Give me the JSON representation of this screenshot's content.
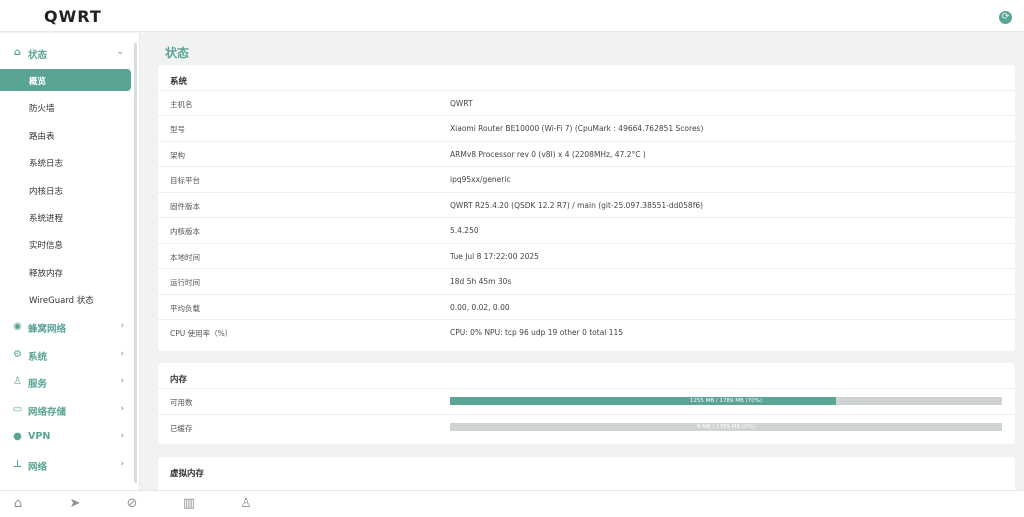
{
  "header": {
    "brand": "QWRT",
    "refresh_icon": "refresh-icon"
  },
  "sidebar": {
    "groups": [
      {
        "label": "状态",
        "icon": "home-icon"
      },
      {
        "label": "蜂窝网络",
        "icon": "cellular-icon"
      },
      {
        "label": "系统",
        "icon": "gear-icon"
      },
      {
        "label": "服务",
        "icon": "user-icon"
      },
      {
        "label": "网络存储",
        "icon": "storage-icon"
      },
      {
        "label": "VPN",
        "icon": "globe-icon"
      },
      {
        "label": "网络",
        "icon": "network-icon"
      }
    ],
    "status_items": [
      "概览",
      "防火墙",
      "路由表",
      "系统日志",
      "内核日志",
      "系统进程",
      "实时信息",
      "释放内存",
      "WireGuard 状态"
    ],
    "active_item": "概览"
  },
  "main": {
    "page_title": "状态",
    "system": {
      "title": "系统",
      "rows": [
        {
          "k": "主机名",
          "v": "QWRT"
        },
        {
          "k": "型号",
          "v": "Xiaomi Router BE10000 (Wi-Fi 7) (CpuMark : 49664.762851 Scores)"
        },
        {
          "k": "架构",
          "v": "ARMv8 Processor rev 0 (v8l) x 4 (2208MHz, 47.2°C )"
        },
        {
          "k": "目标平台",
          "v": "ipq95xx/generic"
        },
        {
          "k": "固件版本",
          "v": "QWRT R25.4.20 (QSDK 12.2 R7) / main (git-25.097.38551-dd058f6)"
        },
        {
          "k": "内核版本",
          "v": "5.4.250"
        },
        {
          "k": "本地时间",
          "v": "Tue Jul 8 17:22:00 2025"
        },
        {
          "k": "运行时间",
          "v": "18d 5h 45m 30s"
        },
        {
          "k": "平均负载",
          "v": "0.00, 0.02, 0.00"
        },
        {
          "k": "CPU 使用率（%）",
          "v": "CPU: 0% NPU: tcp 96 udp 19 other 0 total 115"
        }
      ]
    },
    "memory": {
      "title": "内存",
      "rows": [
        {
          "k": "可用数",
          "text": "1255 MB / 1789 MB (70%)",
          "fraction": 0.7
        },
        {
          "k": "已缓存",
          "text": "9 MB / 1789 MB (0%)",
          "fraction": 0.0
        }
      ]
    },
    "swap": {
      "title": "虚拟内存"
    }
  },
  "bottom_nav": [
    "home-icon",
    "send-icon",
    "compass-icon",
    "chart-icon",
    "user-icon"
  ],
  "colors": {
    "accent": "#5aa495",
    "bar_bg": "#cfd3d3",
    "page_bg": "#f1f3f3"
  }
}
